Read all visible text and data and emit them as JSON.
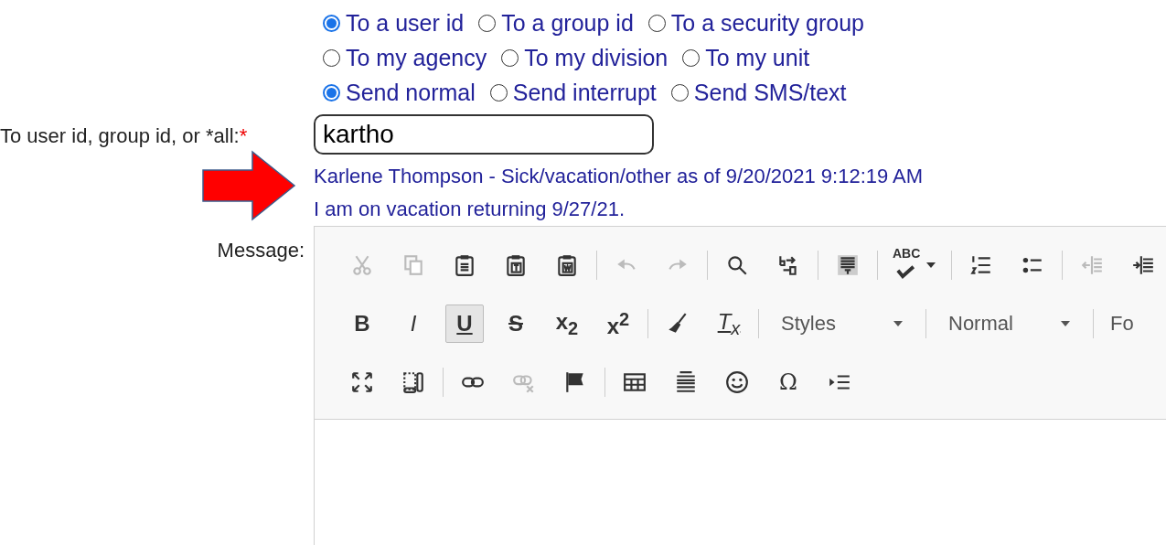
{
  "recipient_type_rows": [
    {
      "options": [
        {
          "label": "To a user id",
          "selected": true
        },
        {
          "label": "To a group id",
          "selected": false
        },
        {
          "label": "To a security group",
          "selected": false
        }
      ]
    },
    {
      "options": [
        {
          "label": "To my agency",
          "selected": false
        },
        {
          "label": "To my division",
          "selected": false
        },
        {
          "label": "To my unit",
          "selected": false
        }
      ]
    }
  ],
  "send_modes": [
    {
      "label": "Send normal",
      "selected": true
    },
    {
      "label": "Send interrupt",
      "selected": false
    },
    {
      "label": "Send SMS/text",
      "selected": false
    }
  ],
  "recipient_field": {
    "label": "To user id, group id, or *all:",
    "required_mark": "*",
    "value": "kartho"
  },
  "lookup_result": [
    "Karlene Thompson - Sick/vacation/other as of 9/20/2021 9:12:19 AM",
    "I am on vacation returning 9/27/21."
  ],
  "message": {
    "label": "Message:"
  },
  "toolbar_rows": [
    {
      "items": [
        {
          "kind": "icon",
          "disabled": true,
          "on": false
        },
        {
          "kind": "icon",
          "disabled": true,
          "on": false
        },
        {
          "kind": "icon",
          "disabled": false,
          "on": false
        },
        {
          "kind": "icon",
          "disabled": false,
          "on": false
        },
        {
          "kind": "icon",
          "disabled": false,
          "on": false
        },
        {
          "kind": "separator"
        },
        {
          "kind": "icon",
          "disabled": true,
          "on": false
        },
        {
          "kind": "icon",
          "disabled": true,
          "on": false
        },
        {
          "kind": "separator"
        },
        {
          "kind": "icon",
          "disabled": false,
          "on": false
        },
        {
          "kind": "icon",
          "disabled": false,
          "on": false
        },
        {
          "kind": "separator"
        },
        {
          "kind": "icon",
          "disabled": false,
          "on": false
        },
        {
          "kind": "separator"
        },
        {
          "kind": "spell",
          "text": "ABC",
          "disabled": false,
          "on": false
        },
        {
          "kind": "separator"
        },
        {
          "kind": "icon",
          "disabled": false,
          "on": false
        },
        {
          "kind": "icon",
          "disabled": false,
          "on": false
        },
        {
          "kind": "separator"
        },
        {
          "kind": "icon",
          "disabled": true,
          "on": false
        },
        {
          "kind": "icon",
          "disabled": false,
          "on": false
        }
      ]
    },
    {
      "items": [
        {
          "kind": "glyph",
          "text": "B",
          "disabled": false,
          "on": false
        },
        {
          "kind": "glyph",
          "text": "I",
          "disabled": false,
          "on": false
        },
        {
          "kind": "glyph",
          "text": "U",
          "disabled": false,
          "on": true
        },
        {
          "kind": "glyph",
          "text": "S",
          "disabled": false,
          "on": false
        },
        {
          "kind": "glyph",
          "text": "x$_{2}$",
          "disabled": false,
          "on": false
        },
        {
          "kind": "glyph",
          "text": "x$^{2}$",
          "disabled": false,
          "on": false
        },
        {
          "kind": "separator"
        },
        {
          "kind": "icon",
          "disabled": false,
          "on": false
        },
        {
          "kind": "glyph",
          "text": "T$_{x}$",
          "disabled": false,
          "on": false
        },
        {
          "kind": "separator"
        },
        {
          "kind": "combo",
          "text": "Styles"
        },
        {
          "kind": "separator"
        },
        {
          "kind": "combo",
          "text": "Normal"
        },
        {
          "kind": "separator"
        },
        {
          "kind": "cut",
          "text": "Fo"
        }
      ]
    },
    {
      "items": [
        {
          "kind": "icon",
          "disabled": false,
          "on": false
        },
        {
          "kind": "icon",
          "disabled": false,
          "on": false
        },
        {
          "kind": "separator"
        },
        {
          "kind": "icon",
          "disabled": false,
          "on": false
        },
        {
          "kind": "icon",
          "disabled": true,
          "on": false
        },
        {
          "kind": "icon",
          "disabled": false,
          "on": false
        },
        {
          "kind": "separator"
        },
        {
          "kind": "icon",
          "disabled": false,
          "on": false
        },
        {
          "kind": "icon",
          "disabled": false,
          "on": false
        },
        {
          "kind": "icon",
          "disabled": false,
          "on": false
        },
        {
          "kind": "glyph",
          "text": "Ω",
          "disabled": false,
          "on": false
        },
        {
          "kind": "icon",
          "disabled": false,
          "on": false
        }
      ]
    }
  ]
}
